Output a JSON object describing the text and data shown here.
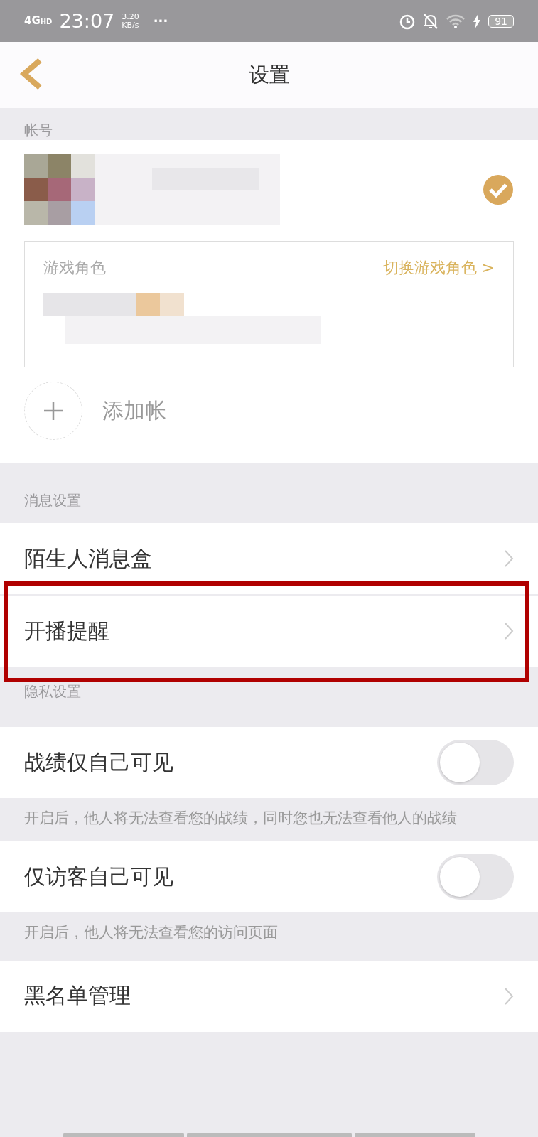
{
  "status_bar": {
    "network": "4G",
    "network_sup": "HD",
    "time": "23:07",
    "speed_value": "3.20",
    "speed_unit": "KB/s",
    "more": "···",
    "battery": "91"
  },
  "header": {
    "title": "设置"
  },
  "account_section": {
    "label": "帐号",
    "account": {
      "selected": true,
      "kind": "picture"
    },
    "role_card": {
      "label": "游戏角色",
      "switch_link": "切换游戏角色 >"
    },
    "add_account": "添加帐"
  },
  "message_section": {
    "label": "消息设置",
    "rows": [
      {
        "label": "陌生人消息盒",
        "highlighted": false
      },
      {
        "label": "开播提醒",
        "highlighted": true
      }
    ]
  },
  "privacy_section": {
    "label": "隐私设置",
    "rows": [
      {
        "label": "战绩仅自己可见",
        "on": false,
        "note": "开启后，他人将无法查看您的战绩，同时您也无法查看他人的战绩"
      },
      {
        "label": "仅访客自己可见",
        "on": false,
        "note": "开启后，他人将无法查看您的访问页面"
      }
    ]
  },
  "blacklist": {
    "label": "黑名单管理"
  }
}
